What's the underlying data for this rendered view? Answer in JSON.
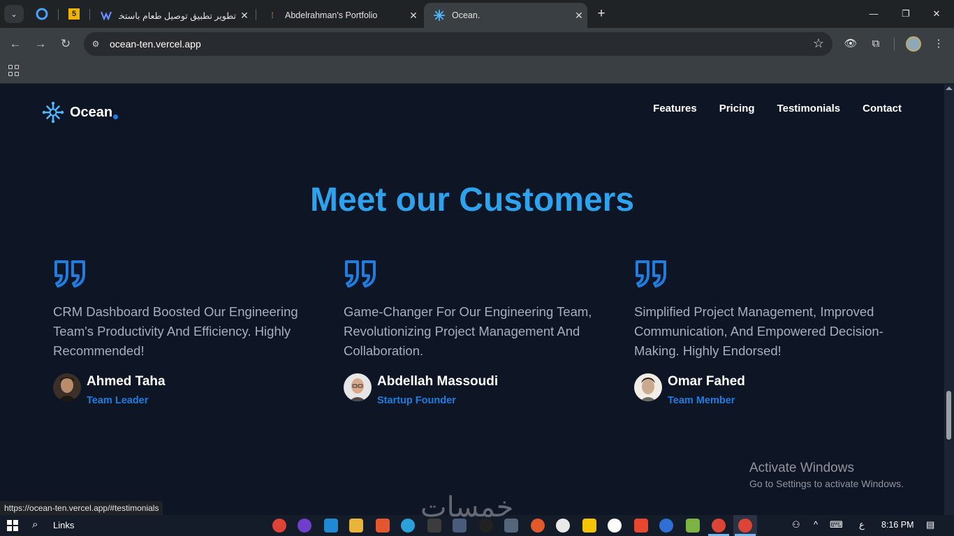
{
  "browser": {
    "tabs": [
      {
        "title": "",
        "icon": "circle-app-icon"
      },
      {
        "title": "",
        "icon": "five-app-icon"
      },
      {
        "title": "تطوير تطبيق توصيل طعام باستخد",
        "icon": "freelance-icon"
      },
      {
        "title": "Abdelrahman's Portfolio",
        "icon": "portfolio-icon"
      },
      {
        "title": "Ocean.",
        "icon": "ocean-logo-icon",
        "active": true
      }
    ],
    "close_glyph": "✕",
    "new_tab_glyph": "+",
    "url": "ocean-ten.vercel.app",
    "status_url": "https://ocean-ten.vercel.app/#testimonials"
  },
  "site": {
    "brand": "Ocean",
    "nav": [
      "Features",
      "Pricing",
      "Testimonials",
      "Contact"
    ],
    "headline": "Meet our Customers",
    "testimonials": [
      {
        "text": "CRM Dashboard Boosted Our Engineering Team's Productivity And Efficiency. Highly Recommended!",
        "name": "Ahmed Taha",
        "role": "Team Leader"
      },
      {
        "text": "Game-Changer For Our Engineering Team, Revolutionizing Project Management And Collaboration.",
        "name": "Abdellah Massoudi",
        "role": "Startup Founder"
      },
      {
        "text": "Simplified Project Management, Improved Communication, And Empowered Decision-Making. Highly Endorsed!",
        "name": "Omar Fahed",
        "role": "Team Member"
      }
    ]
  },
  "windows": {
    "activation_title": "Activate Windows",
    "activation_sub": "Go to Settings to activate Windows.",
    "taskbar_search_label": "Links",
    "clock": "8:16 PM",
    "input_lang": "ع"
  },
  "overlay_watermark": "خمسات",
  "colors": {
    "accent": "#2fa2ee",
    "role": "#1f7de0",
    "page_bg": "#0e1525"
  }
}
